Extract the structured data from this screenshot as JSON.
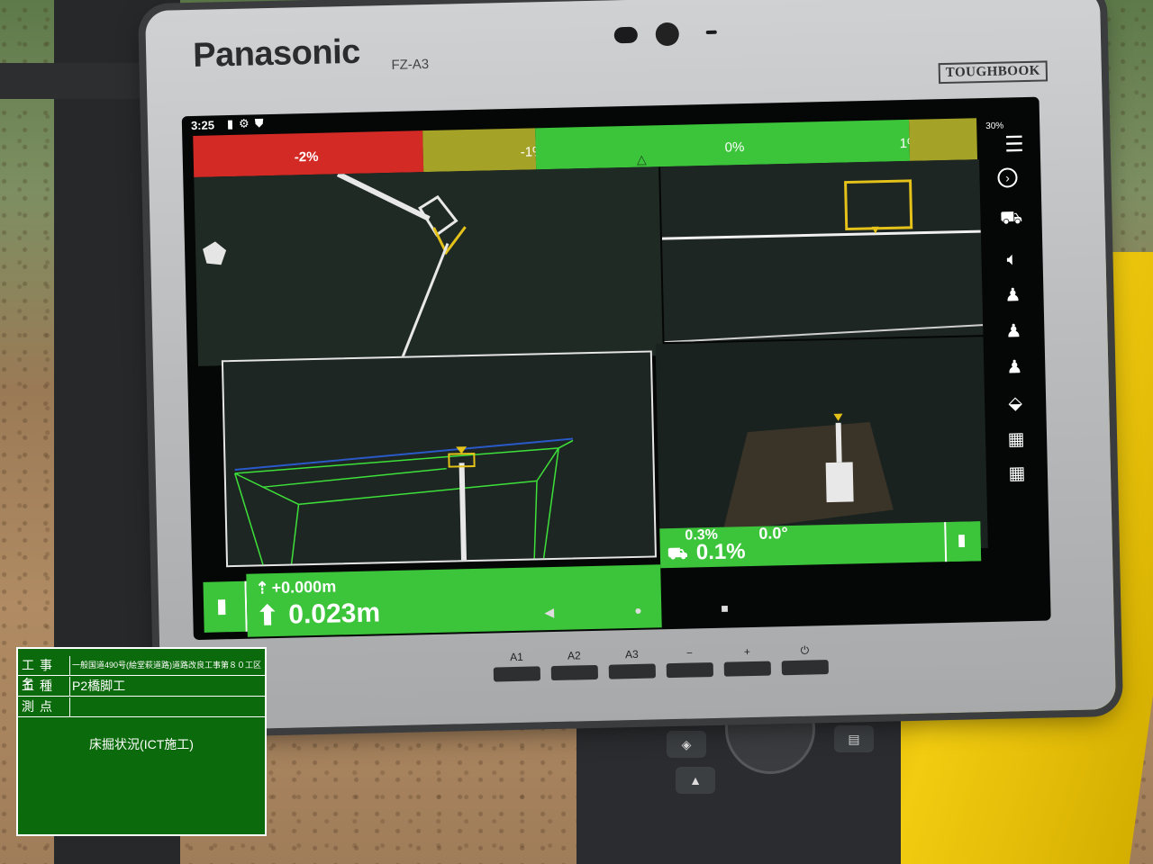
{
  "device": {
    "brand": "Panasonic",
    "model": "FZ-A3",
    "series": "TOUGHBOOK",
    "buttons": [
      "A1",
      "A2",
      "A3",
      "−",
      "+",
      "⏻"
    ]
  },
  "status_bar": {
    "time": "3:25",
    "battery": "30%"
  },
  "grade_bar": {
    "ticks": [
      "-2%",
      "-1%",
      "0%",
      "1%"
    ]
  },
  "readouts": {
    "elevation_offset": "+0.000m",
    "cut_depth": "0.023m",
    "pitch": "0.3%",
    "roll": "0.0°",
    "slope": "0.1%"
  },
  "icons": {
    "menu": "menu-icon",
    "next": "chevron-right-icon",
    "machine": "excavator-icon",
    "sound": "speaker-icon",
    "operator1": "operator-1-icon",
    "operator2": "operator-2-icon",
    "operator3": "operator-3-icon",
    "bucket": "bucket-icon",
    "measure1": "measure-a-icon",
    "measure2": "measure-b-icon"
  },
  "photo_board": {
    "rows": [
      {
        "key": "工事名",
        "value": "一般国道490号(絵堂萩道路)道路改良工事第８０工区"
      },
      {
        "key": "工種",
        "value": "P2橋脚工"
      },
      {
        "key": "測点",
        "value": ""
      }
    ],
    "note": "床掘状況(ICT施工)"
  },
  "colors": {
    "grade_red": "#d42a25",
    "grade_olive": "#a4a328",
    "grade_green": "#3cc43a",
    "board_green": "#0b6a0b",
    "bucket_yellow": "#e5c21a"
  }
}
